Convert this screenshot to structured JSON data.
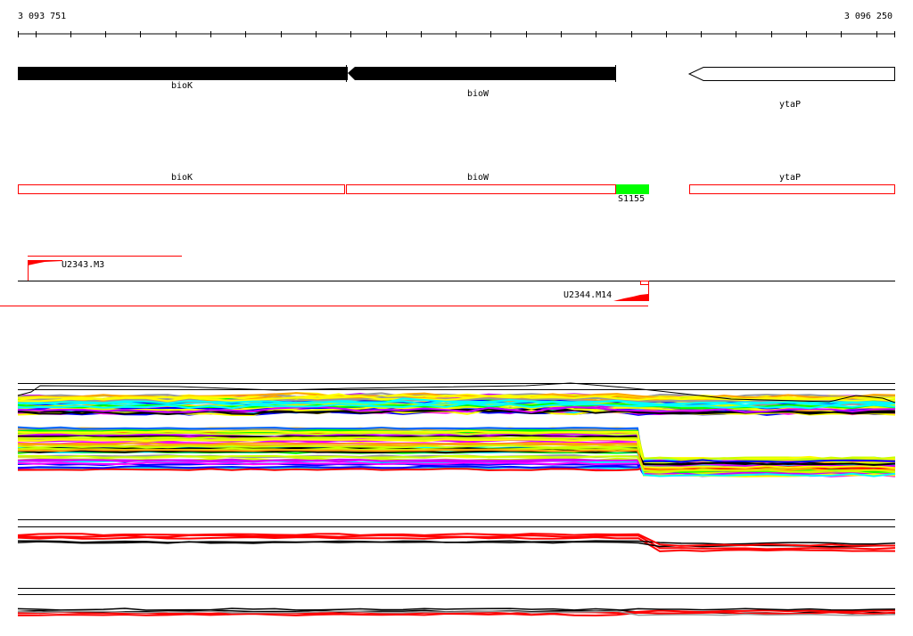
{
  "ruler": {
    "start_label": "3 093 751",
    "end_label": "3 096 250"
  },
  "genes": [
    {
      "name": "bioK",
      "strand": "-",
      "style": "filled"
    },
    {
      "name": "bioW",
      "strand": "-",
      "style": "filled"
    },
    {
      "name": "ytaP",
      "strand": "-",
      "style": "outline"
    }
  ],
  "annotation_track": {
    "boxes": [
      {
        "label": "bioK"
      },
      {
        "label": "bioW"
      },
      {
        "label": "ytaP"
      }
    ],
    "feature": {
      "label": "S1155",
      "color": "#00ff00"
    }
  },
  "transcripts": [
    {
      "label": "U2343.M3",
      "color": "#ff0000"
    },
    {
      "label": "U2344.M14",
      "color": "#ff0000"
    }
  ],
  "colors": {
    "outline": "#ff0000",
    "trace_palette": [
      "#ff0000",
      "#00ff00",
      "#0000ff",
      "#ff00ff",
      "#00ffff",
      "#ffa500",
      "#999999",
      "#ccff00",
      "#000000",
      "#0066ff",
      "#ffff00",
      "#cc00ff"
    ]
  }
}
